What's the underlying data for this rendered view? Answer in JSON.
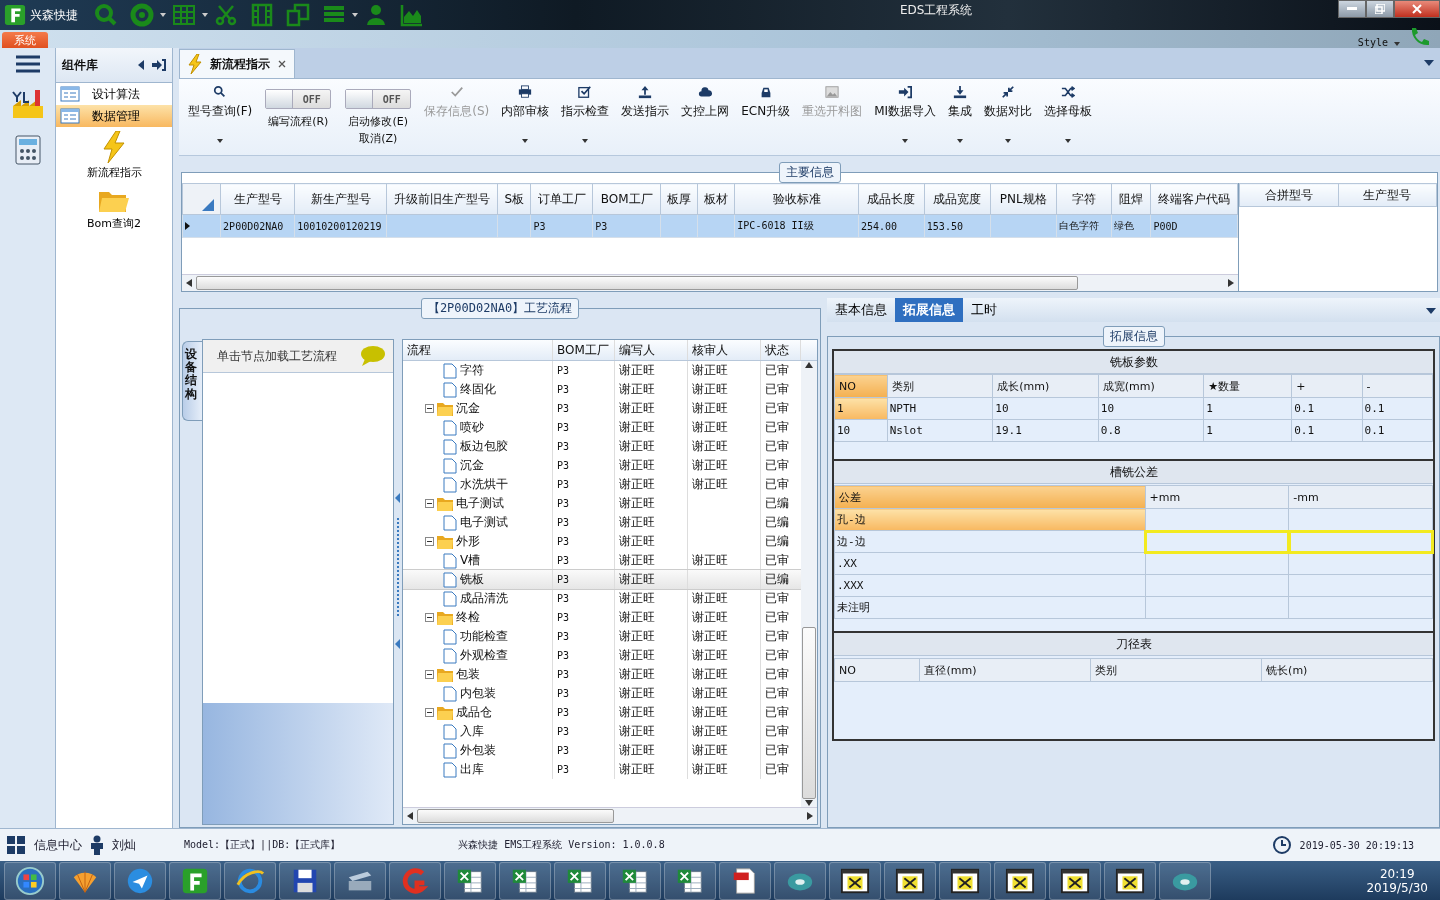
{
  "title_bar": {
    "app_name": "兴森快捷",
    "title": "EDS工程系统"
  },
  "ribbon": {
    "tab": "系统",
    "style_menu": "Style"
  },
  "sidebar": {
    "header": "组件库",
    "items": [
      {
        "label": "设计算法",
        "selected": false
      },
      {
        "label": "数据管理",
        "selected": true
      }
    ],
    "tools": [
      {
        "label": "新流程指示"
      },
      {
        "label": "Bom查询2"
      }
    ]
  },
  "doc_tab": {
    "title": "新流程指示"
  },
  "toolbar": [
    {
      "kind": "button",
      "label": "型号查询(F)",
      "dropdown": true,
      "disabled": false
    },
    {
      "kind": "toggle",
      "label": "编写流程(R)",
      "state": "OFF",
      "on": false
    },
    {
      "kind": "toggle",
      "label": "启动修改(E)",
      "label2": "取消(Z)",
      "state": "OFF",
      "on": false
    },
    {
      "kind": "button",
      "label": "保存信息(S)",
      "dropdown": false,
      "disabled": true
    },
    {
      "kind": "button",
      "label": "内部审核",
      "dropdown": true,
      "disabled": false
    },
    {
      "kind": "button",
      "label": "指示检查",
      "dropdown": true,
      "disabled": false
    },
    {
      "kind": "button",
      "label": "发送指示",
      "dropdown": false,
      "disabled": false
    },
    {
      "kind": "button",
      "label": "文控上网",
      "dropdown": false,
      "disabled": false
    },
    {
      "kind": "button",
      "label": "ECN升级",
      "dropdown": false,
      "disabled": false
    },
    {
      "kind": "button",
      "label": "重选开料图",
      "dropdown": false,
      "disabled": true
    },
    {
      "kind": "button",
      "label": "MI数据导入",
      "dropdown": true,
      "disabled": false
    },
    {
      "kind": "button",
      "label": "集成",
      "dropdown": true,
      "disabled": false
    },
    {
      "kind": "button",
      "label": "数据对比",
      "dropdown": true,
      "disabled": false
    },
    {
      "kind": "button",
      "label": "选择母板",
      "dropdown": true,
      "disabled": false
    }
  ],
  "main_info": {
    "title": "主要信息",
    "columns": [
      "生产型号",
      "新生产型号",
      "升级前旧生产型号",
      "S板",
      "订单工厂",
      "BOM工厂",
      "板厚",
      "板材",
      "验收标准",
      "成品长度",
      "成品宽度",
      "PNL规格",
      "字符",
      "阻焊",
      "终端客户代码"
    ],
    "rows": [
      {
        "selected": true,
        "cells": [
          "2P00D02NA0",
          "10010200120219",
          null,
          null,
          "P3",
          "P3",
          null,
          null,
          "IPC-6018 II级",
          "254.00",
          "153.50",
          null,
          "白色字符",
          "绿色",
          "P00D"
        ]
      }
    ],
    "side_columns": [
      "合拼型号",
      "生产型号"
    ]
  },
  "process": {
    "title": "【2P00D02NA0】工艺流程",
    "side_tab": "设备结构",
    "hint": "单击节点加载工艺流程",
    "columns": [
      "流程",
      "BOM工厂",
      "编写人",
      "核审人",
      "状态"
    ],
    "tree": [
      {
        "children": [
          {
            "label": "字符",
            "bom": "P3",
            "writer": "谢正旺",
            "reviewer": "谢正旺",
            "status": "已审",
            "selected": false
          },
          {
            "label": "终固化",
            "bom": "P3",
            "writer": "谢正旺",
            "reviewer": "谢正旺",
            "status": "已审",
            "selected": false
          }
        ]
      },
      {
        "label": "沉金",
        "bom": "P3",
        "writer": "谢正旺",
        "reviewer": "谢正旺",
        "status": "已审",
        "selected": false,
        "children": [
          {
            "label": "喷砂",
            "bom": "P3",
            "writer": "谢正旺",
            "reviewer": "谢正旺",
            "status": "已审",
            "selected": false
          },
          {
            "label": "板边包胶",
            "bom": "P3",
            "writer": "谢正旺",
            "reviewer": "谢正旺",
            "status": "已审",
            "selected": false
          },
          {
            "label": "沉金",
            "bom": "P3",
            "writer": "谢正旺",
            "reviewer": "谢正旺",
            "status": "已审",
            "selected": false
          },
          {
            "label": "水洗烘干",
            "bom": "P3",
            "writer": "谢正旺",
            "reviewer": "谢正旺",
            "status": "已审",
            "selected": false
          }
        ]
      },
      {
        "label": "电子测试",
        "bom": "P3",
        "writer": "谢正旺",
        "status": "已编",
        "selected": false,
        "children": [
          {
            "label": "电子测试",
            "bom": "P3",
            "writer": "谢正旺",
            "status": "已编",
            "selected": false
          }
        ]
      },
      {
        "label": "外形",
        "bom": "P3",
        "writer": "谢正旺",
        "status": "已编",
        "selected": false,
        "children": [
          {
            "label": "V槽",
            "bom": "P3",
            "writer": "谢正旺",
            "reviewer": "谢正旺",
            "status": "已审",
            "selected": false
          },
          {
            "label": "铣板",
            "bom": "P3",
            "writer": "谢正旺",
            "status": "已编",
            "selected": true
          },
          {
            "label": "成品清洗",
            "bom": "P3",
            "writer": "谢正旺",
            "reviewer": "谢正旺",
            "status": "已审",
            "selected": false
          }
        ]
      },
      {
        "label": "终检",
        "bom": "P3",
        "writer": "谢正旺",
        "reviewer": "谢正旺",
        "status": "已审",
        "selected": false,
        "children": [
          {
            "label": "功能检查",
            "bom": "P3",
            "writer": "谢正旺",
            "reviewer": "谢正旺",
            "status": "已审",
            "selected": false
          },
          {
            "label": "外观检查",
            "bom": "P3",
            "writer": "谢正旺",
            "reviewer": "谢正旺",
            "status": "已审",
            "selected": false
          }
        ]
      },
      {
        "label": "包装",
        "bom": "P3",
        "writer": "谢正旺",
        "reviewer": "谢正旺",
        "status": "已审",
        "selected": false,
        "children": [
          {
            "label": "内包装",
            "bom": "P3",
            "writer": "谢正旺",
            "reviewer": "谢正旺",
            "status": "已审",
            "selected": false
          }
        ]
      },
      {
        "label": "成品仓",
        "bom": "P3",
        "writer": "谢正旺",
        "reviewer": "谢正旺",
        "status": "已审",
        "selected": false,
        "children": [
          {
            "label": "入库",
            "bom": "P3",
            "writer": "谢正旺",
            "reviewer": "谢正旺",
            "status": "已审",
            "selected": false
          },
          {
            "label": "外包装",
            "bom": "P3",
            "writer": "谢正旺",
            "reviewer": "谢正旺",
            "status": "已审",
            "selected": false
          },
          {
            "label": "出库",
            "bom": "P3",
            "writer": "谢正旺",
            "reviewer": "谢正旺",
            "status": "已审",
            "selected": false
          }
        ]
      }
    ]
  },
  "details": {
    "tabs": [
      {
        "label": "基本信息",
        "selected": false
      },
      {
        "label": "拓展信息",
        "selected": true
      },
      {
        "label": "工时",
        "selected": false
      }
    ],
    "group": "拓展信息",
    "milling": {
      "title": "铣板参数",
      "columns": [
        "NO",
        "类别",
        "成长(mm)",
        "成宽(mm)",
        "★数量",
        "+",
        "-"
      ],
      "rows": [
        {
          "selected": true,
          "cells": [
            "1",
            "NPTH",
            "10",
            "10",
            "1",
            "0.1",
            "0.1"
          ]
        },
        {
          "selected": false,
          "cells": [
            "10",
            "Nslot",
            "19.1",
            "0.8",
            "1",
            "0.1",
            "0.1"
          ]
        }
      ]
    },
    "tolerance": {
      "title": "槽铣公差",
      "columns": [
        "公差",
        "+mm",
        "-mm"
      ],
      "rows": [
        {
          "label": "孔-边",
          "selected": true,
          "focused": false
        },
        {
          "label": "边-边",
          "selected": false,
          "focused": true
        },
        {
          "label": ".XX",
          "selected": false,
          "focused": false
        },
        {
          "label": ".XXX",
          "selected": false,
          "focused": false
        },
        {
          "label": "未注明",
          "selected": false,
          "focused": false
        }
      ]
    },
    "cutters": {
      "title": "刀径表",
      "columns": [
        "NO",
        "直径(mm)",
        "类别",
        "铣长(m)"
      ]
    }
  },
  "status_bar": {
    "info_center": "信息中心",
    "user": "刘灿",
    "model": "Model:【正式】||DB:【正式库】",
    "version": "兴森快捷 EMS工程系统 Version: 1.0.0.8",
    "datetime": "2019-05-30 20:19:13"
  },
  "taskbar": {
    "time": "20:19",
    "date": "2019/5/30"
  }
}
